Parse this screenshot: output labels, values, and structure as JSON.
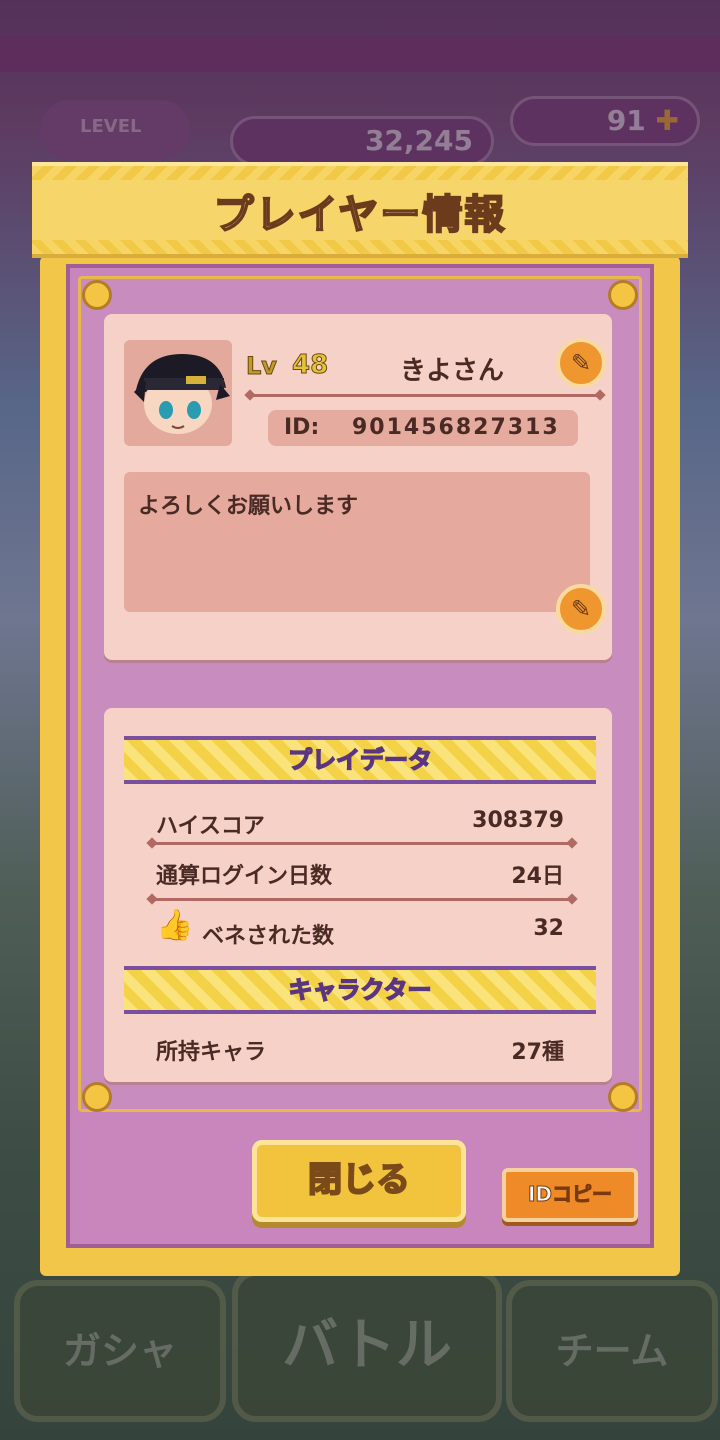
{
  "background": {
    "level_label": "LEVEL",
    "coins": "32,245",
    "gems": "91",
    "nav": [
      "ガシャ",
      "バトル",
      "チーム"
    ]
  },
  "modal": {
    "title": "プレイヤー情報",
    "profile": {
      "lv_label": "Lv",
      "level": "48",
      "name": "きよさん",
      "id_label": "ID:",
      "id_value": "901456827313",
      "message": "よろしくお願いします"
    },
    "play_data": {
      "heading": "プレイデータ",
      "rows": [
        {
          "label": "ハイスコア",
          "value": "308379"
        },
        {
          "label": "通算ログイン日数",
          "value": "24日"
        },
        {
          "label": "ベネされた数",
          "value": "32"
        }
      ]
    },
    "character": {
      "heading": "キャラクター",
      "rows": [
        {
          "label": "所持キャラ",
          "value": "27種"
        }
      ]
    },
    "buttons": {
      "close": "閉じる",
      "copy_id": "IDコピー"
    }
  },
  "colors": {
    "header_yellow": "#f6d56b",
    "panel_pink": "#c886bd",
    "card": "#f6d1c7",
    "ribbon_border": "#7a4fa0",
    "copy_orange": "#ee8b28"
  }
}
